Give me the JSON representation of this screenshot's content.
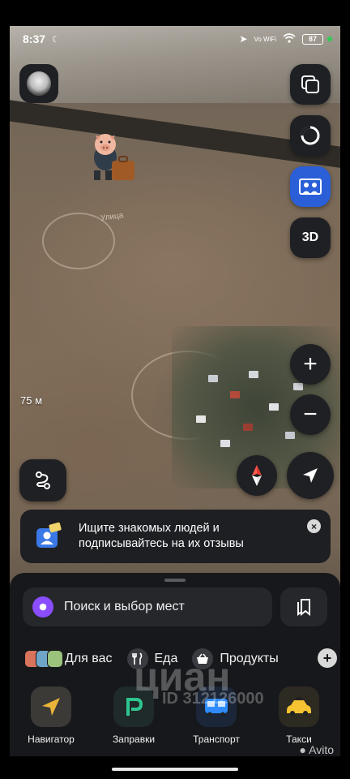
{
  "status_bar": {
    "time": "8:37",
    "network_label": "Vo WiFi",
    "battery": "87"
  },
  "map": {
    "place_label": "Улица",
    "scale": "75 м",
    "buttons": {
      "view_3d": "3D",
      "zoom_in": "+",
      "zoom_out": "−"
    }
  },
  "toast": {
    "text": "Ищите знакомых людей и подписывайтесь на их отзывы",
    "close": "×"
  },
  "search": {
    "placeholder": "Поиск и выбор мест"
  },
  "categories": [
    {
      "label": "Для вас",
      "icon": "stacked-photos-icon"
    },
    {
      "label": "Еда",
      "icon": "fork-knife-icon"
    },
    {
      "label": "Продукты",
      "icon": "basket-icon"
    }
  ],
  "more_label": "+",
  "apps": [
    {
      "label": "Навигатор",
      "icon": "navigator-arrow-icon",
      "color": "#e8b53a"
    },
    {
      "label": "Заправки",
      "icon": "fuel-p-icon",
      "color": "#2ec58f"
    },
    {
      "label": "Транспорт",
      "icon": "bus-icon",
      "color": "#2f8cff"
    },
    {
      "label": "Такси",
      "icon": "taxi-car-icon",
      "color": "#f6c432"
    }
  ],
  "watermark": {
    "brand": "циан",
    "id": "ID 312126000",
    "avito": "Avito"
  },
  "colors": {
    "panel": "#1f2024",
    "sheet": "#17181b",
    "accent_purple": "#8a4dff",
    "toast_icon_blue": "#3a78e6"
  }
}
